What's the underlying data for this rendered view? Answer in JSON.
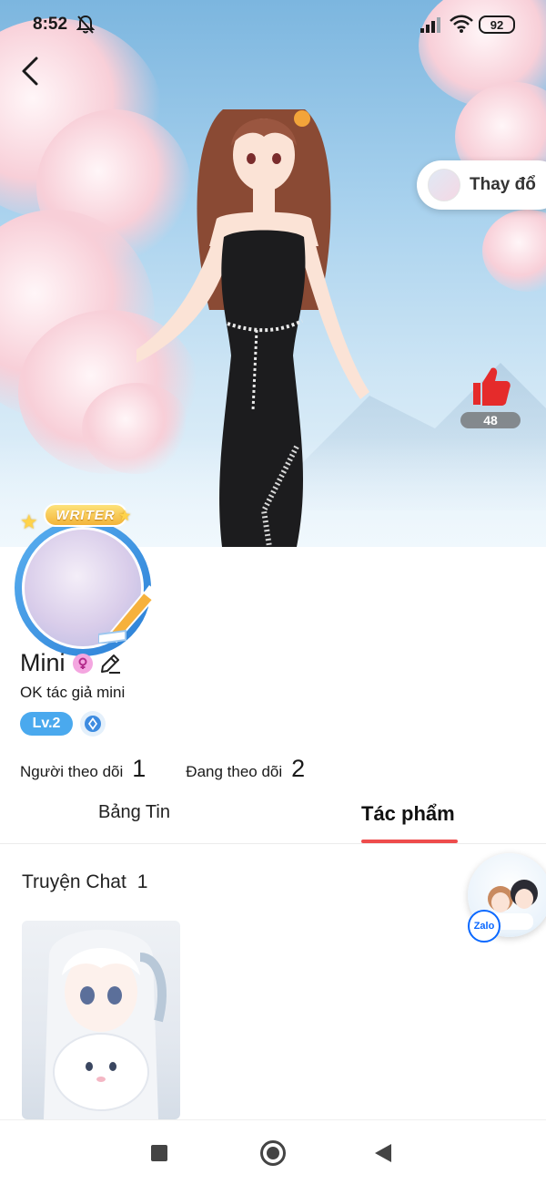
{
  "status_bar": {
    "time": "8:52",
    "battery": "92",
    "icons": [
      "bell-off-icon",
      "signal-icon",
      "wifi-icon",
      "battery-icon"
    ]
  },
  "hero": {
    "change_button_label": "Thay đổ",
    "like_count": "48"
  },
  "profile": {
    "badge_label": "WRITER",
    "name": "Mini",
    "bio": "OK tác giả mini",
    "level": "Lv.2",
    "followers_label": "Người theo dõi",
    "followers_count": "1",
    "following_label": "Đang theo dõi",
    "following_count": "2"
  },
  "tabs": [
    {
      "label": "Bảng Tin",
      "active": false
    },
    {
      "label": "Tác phẩm",
      "active": true
    }
  ],
  "section": {
    "title": "Truyện Chat",
    "count": "1"
  },
  "floating": {
    "zalo_label": "Zalo"
  },
  "colors": {
    "accent_red": "#ee4c4c",
    "level_blue": "#4aa9ee",
    "like_red": "#e52b2b"
  }
}
